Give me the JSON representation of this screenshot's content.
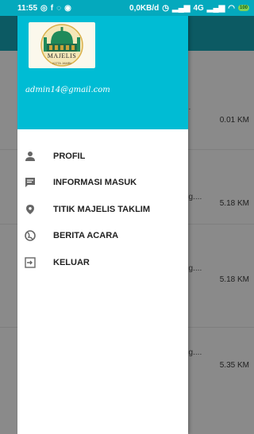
{
  "status_bar": {
    "time": "11:55",
    "data_rate": "0,0KB/d",
    "network": "4G",
    "battery": "100"
  },
  "drawer": {
    "logo": {
      "title": "MAJELIS",
      "subtitle": "KOTA JAMBI"
    },
    "email": "admin14@gmail.com",
    "menu": [
      {
        "label": "PROFIL",
        "icon": "person-icon"
      },
      {
        "label": "INFORMASI MASUK",
        "icon": "message-icon"
      },
      {
        "label": "TITIK MAJELIS TAKLIM",
        "icon": "location-icon"
      },
      {
        "label": "BERITA ACARA",
        "icon": "globe-icon"
      },
      {
        "label": "KELUAR",
        "icon": "logout-icon"
      }
    ]
  },
  "background_list": {
    "items": [
      {
        "snippet": "...",
        "distance": "0.01 KM"
      },
      {
        "snippet": "ng....",
        "distance": "5.18 KM"
      },
      {
        "snippet": "ng....",
        "distance": "5.18 KM"
      },
      {
        "snippet": "ng....",
        "distance": "5.35 KM"
      }
    ]
  },
  "colors": {
    "header": "#00bcd4",
    "status_bar": "#04a9bd",
    "dim_overlay": "#8a8a8a"
  }
}
